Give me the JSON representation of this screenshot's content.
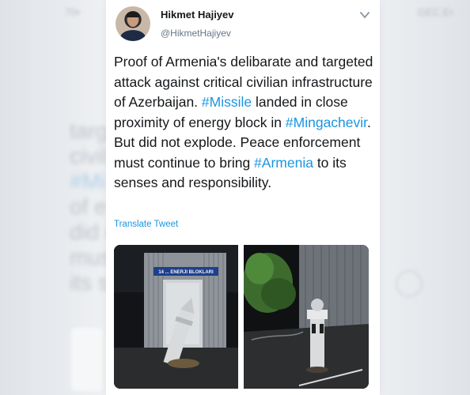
{
  "tweet": {
    "author_name": "Hikmet Hajiyev",
    "author_handle": "@HikmetHajiyev",
    "text_parts": [
      {
        "text": "Proof of Armenia's delibarate and targeted attack against critical civilian infrastructure of Azerbaijan. ",
        "hashtag": false
      },
      {
        "text": "#Missile",
        "hashtag": true
      },
      {
        "text": " landed in close proximity of energy block in ",
        "hashtag": false
      },
      {
        "text": "#Mingachevir",
        "hashtag": true
      },
      {
        "text": ". But did not explode. Peace enforcement must continue to bring ",
        "hashtag": false
      },
      {
        "text": "#Armenia",
        "hashtag": true
      },
      {
        "text": " to its senses and responsibility.",
        "hashtag": false
      }
    ],
    "translate_label": "Translate Tweet",
    "photo_1_sign": "14 ... ENERJI BLOKLARI",
    "menu_icon": "chevron-down-icon"
  },
  "background": {
    "lines": [
      "targ",
      "civil",
      "#Mi",
      "of e",
      "did r",
      "mus",
      "its s"
    ],
    "left_top": "70•",
    "right_top": "GEC.E•"
  },
  "colors": {
    "link": "#1b95e0",
    "text": "#14171a",
    "secondary": "#657786"
  }
}
